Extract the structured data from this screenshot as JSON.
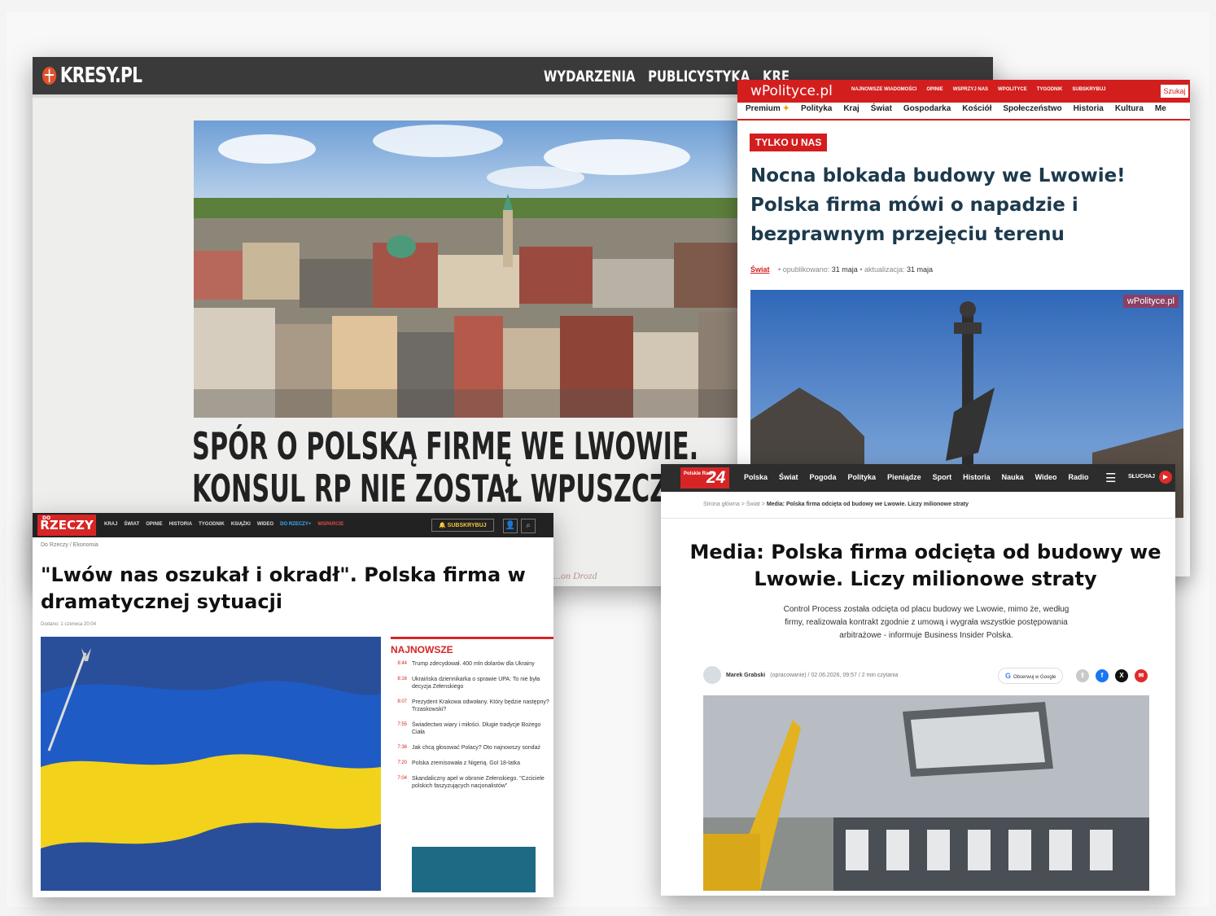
{
  "kresy": {
    "logo": "KRESY.PL",
    "nav": [
      "WYDARZENIA",
      "PUBLICYSTYKA",
      "KRE"
    ],
    "headline_line1": "SPÓR O POLSKĄ FIRMĘ WE LWOWIE.",
    "headline_line2": "KONSUL RP NIE ZOSTAŁ WPUSZCZONY",
    "author": "...on Drozd"
  },
  "wpolityce": {
    "logo": "wPolityce.pl",
    "topnav": [
      "NAJNOWSZE WIADOMOŚCI",
      "OPINIE",
      "WSPRZYJ NAS",
      "WPOLITYCE",
      "TYGODNIK",
      "SUBSKRYBUJ"
    ],
    "search": "Szukaj",
    "categories": [
      "Premium",
      "Polityka",
      "Kraj",
      "Świat",
      "Gospodarka",
      "Kościół",
      "Społeczeństwo",
      "Historia",
      "Kultura",
      "Me"
    ],
    "badge": "TYLKO U NAS",
    "title": "Nocna blokada budowy we Lwowie! Polska firma mówi o napadzie i bezprawnym przejęciu terenu",
    "section": "Świat",
    "published_label": "opublikowano:",
    "published": "31 maja",
    "updated_label": "aktualizacja:",
    "updated": "31 maja",
    "watermark": "wPolityce.pl"
  },
  "dorzeczy": {
    "logo": "RZECZY",
    "logo_small": "DO",
    "nav": [
      "KRAJ",
      "ŚWIAT",
      "OPINIE",
      "HISTORIA",
      "TYGODNIK",
      "KSIĄŻKI",
      "WIDEO"
    ],
    "nav_highlight": "DO RZECZY+",
    "nav_highlight2": "WSPARCIE",
    "subscribe": "SUBSKRYBUJ",
    "breadcrumb": "Do Rzeczy  /  Ekonomia",
    "title": "\"Lwów nas oszukał i okradł\". Polska firma w dramatycznej sytuacji",
    "date": "Dodano: 1 czerwca 20:04",
    "sidebar_heading": "NAJNOWSZE",
    "sidebar_items": [
      {
        "time": "8:44",
        "text": "Trump zdecydował. 400 mln dolarów dla Ukrainy"
      },
      {
        "time": "8:16",
        "text": "Ukraińska dziennikarka o sprawie UPA: To nie była decyzja Zełenskiego"
      },
      {
        "time": "8:07",
        "text": "Prezydent Krakowa odwołany. Który będzie następny? Trzaskowski?"
      },
      {
        "time": "7:55",
        "text": "Świadectwo wiary i miłości. Długie tradycje Bożego Ciała"
      },
      {
        "time": "7:36",
        "text": "Jak chcą głosować Polacy? Oto najnowszy sondaż"
      },
      {
        "time": "7:20",
        "text": "Polska zremisowała z Nigerią. Gol 18-latka"
      },
      {
        "time": "7:04",
        "text": "Skandaliczny apel w obronie Zełenskiego. \"Czciciele polskich faszyzujących nacjonalistów\""
      }
    ]
  },
  "pr24": {
    "logo_small": "Polskie Radio",
    "logo_num": "24",
    "nav": [
      "Polska",
      "Świat",
      "Pogoda",
      "Polityka",
      "Pieniądze",
      "Sport",
      "Historia",
      "Nauka",
      "Wideo",
      "Radio"
    ],
    "listen": "SŁUCHAJ",
    "breadcrumb_pre": "Strona główna  >  Świat  >  ",
    "breadcrumb_current": "Media: Polska firma odcięta od budowy we Lwowie. Liczy milionowe straty",
    "title": "Media: Polska firma odcięta od budowy we Lwowie. Liczy milionowe straty",
    "lead": "Control Process została odcięta od placu budowy we Lwowie, mimo że, według firmy, realizowała kontrakt zgodnie z umową i wygrała wszystkie postępowania arbitrażowe - informuje Business Insider Polska.",
    "author": "Marek Grabski",
    "author_suffix": "(opracowanie)  /  02.06.2026, 09:57  /  2 min czytania",
    "gnews": "Obserwuj w Google"
  },
  "colors": {
    "kresy_bar": "#3a3a3a",
    "wpolityce_red": "#d31e1e",
    "wpolityce_title": "#1c3a4d",
    "dorzeczy_red": "#d72525",
    "pr_red": "#e02b2b"
  }
}
